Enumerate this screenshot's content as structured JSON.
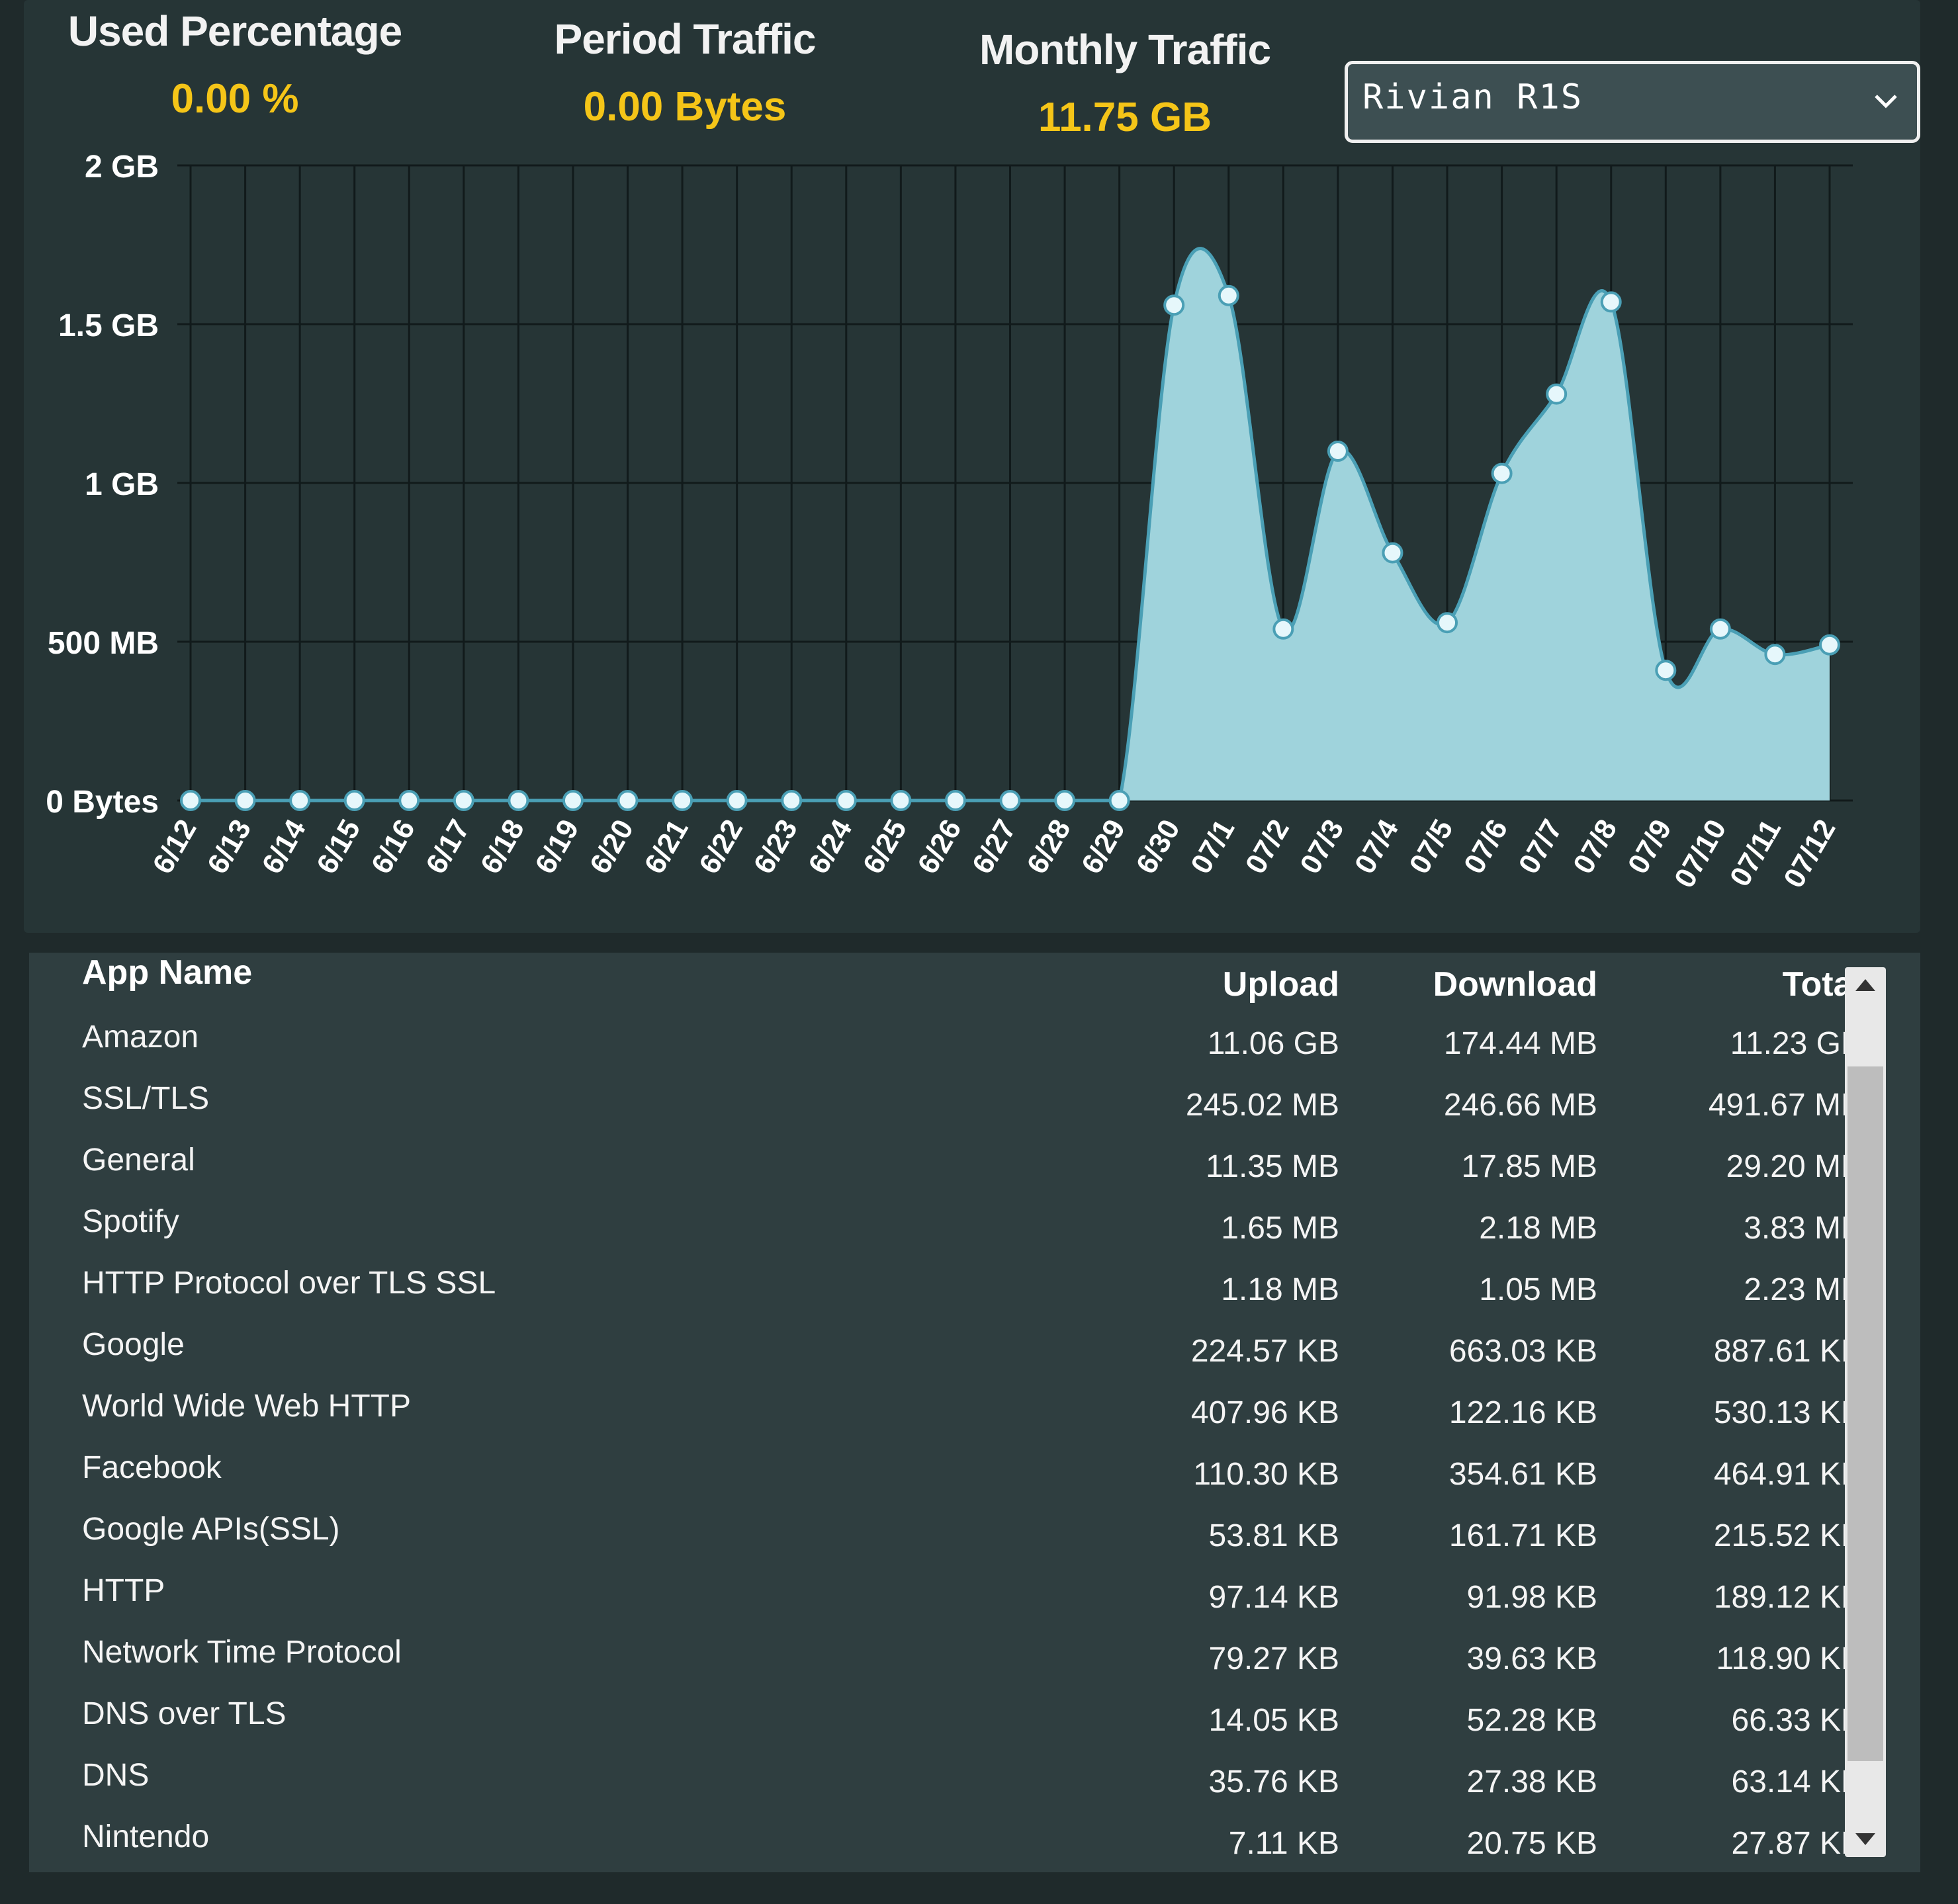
{
  "stats": [
    {
      "title": "Used Percentage",
      "value": "0.00 %"
    },
    {
      "title": "Period Traffic",
      "value": "0.00 Bytes"
    },
    {
      "title": "Monthly Traffic",
      "value": "11.75 GB"
    }
  ],
  "device_select": {
    "value": "Rivian R1S",
    "icon": "chevron-down-icon"
  },
  "colors": {
    "accent_value": "#f5c518",
    "area_fill": "#9fd3dc",
    "line": "#4a9fb5",
    "panel": "#263536"
  },
  "chart_data": {
    "type": "area",
    "categories": [
      "6/12",
      "6/13",
      "6/14",
      "6/15",
      "6/16",
      "6/17",
      "6/18",
      "6/19",
      "6/20",
      "6/21",
      "6/22",
      "6/23",
      "6/24",
      "6/25",
      "6/26",
      "6/27",
      "6/28",
      "6/29",
      "6/30",
      "07/1",
      "07/2",
      "07/3",
      "07/4",
      "07/5",
      "07/6",
      "07/7",
      "07/8",
      "07/9",
      "07/10",
      "07/11",
      "07/12"
    ],
    "series": [
      {
        "values_mb": [
          0,
          0,
          0,
          0,
          0,
          0,
          0,
          0,
          0,
          0,
          0,
          0,
          0,
          0,
          0,
          0,
          0,
          0,
          1560,
          1590,
          540,
          1100,
          780,
          560,
          1030,
          1280,
          1570,
          410,
          540,
          460,
          490
        ]
      }
    ],
    "y_ticks": [
      "0 Bytes",
      "500 MB",
      "1 GB",
      "1.5 GB",
      "2 GB"
    ],
    "y_tick_values_mb": [
      0,
      500,
      1000,
      1500,
      2000
    ],
    "ylim_mb": [
      0,
      2000
    ],
    "grid": true
  },
  "table": {
    "headers": {
      "app": "App Name",
      "upload": "Upload",
      "download": "Download",
      "total": "Total"
    },
    "rows": [
      {
        "app": "Amazon",
        "upload": "11.06 GB",
        "download": "174.44 MB",
        "total": "11.23 GB"
      },
      {
        "app": "SSL/TLS",
        "upload": "245.02 MB",
        "download": "246.66 MB",
        "total": "491.67 MB"
      },
      {
        "app": "General",
        "upload": "11.35 MB",
        "download": "17.85 MB",
        "total": "29.20 MB"
      },
      {
        "app": "Spotify",
        "upload": "1.65 MB",
        "download": "2.18 MB",
        "total": "3.83 MB"
      },
      {
        "app": "HTTP Protocol over TLS SSL",
        "upload": "1.18 MB",
        "download": "1.05 MB",
        "total": "2.23 MB"
      },
      {
        "app": "Google",
        "upload": "224.57 KB",
        "download": "663.03 KB",
        "total": "887.61 KB"
      },
      {
        "app": "World Wide Web HTTP",
        "upload": "407.96 KB",
        "download": "122.16 KB",
        "total": "530.13 KB"
      },
      {
        "app": "Facebook",
        "upload": "110.30 KB",
        "download": "354.61 KB",
        "total": "464.91 KB"
      },
      {
        "app": "Google APIs(SSL)",
        "upload": "53.81 KB",
        "download": "161.71 KB",
        "total": "215.52 KB"
      },
      {
        "app": "HTTP",
        "upload": "97.14 KB",
        "download": "91.98 KB",
        "total": "189.12 KB"
      },
      {
        "app": "Network Time Protocol",
        "upload": "79.27 KB",
        "download": "39.63 KB",
        "total": "118.90 KB"
      },
      {
        "app": "DNS over TLS",
        "upload": "14.05 KB",
        "download": "52.28 KB",
        "total": "66.33 KB"
      },
      {
        "app": "DNS",
        "upload": "35.76 KB",
        "download": "27.38 KB",
        "total": "63.14 KB"
      },
      {
        "app": "Nintendo",
        "upload": "7.11 KB",
        "download": "20.75 KB",
        "total": "27.87 KB"
      }
    ]
  }
}
